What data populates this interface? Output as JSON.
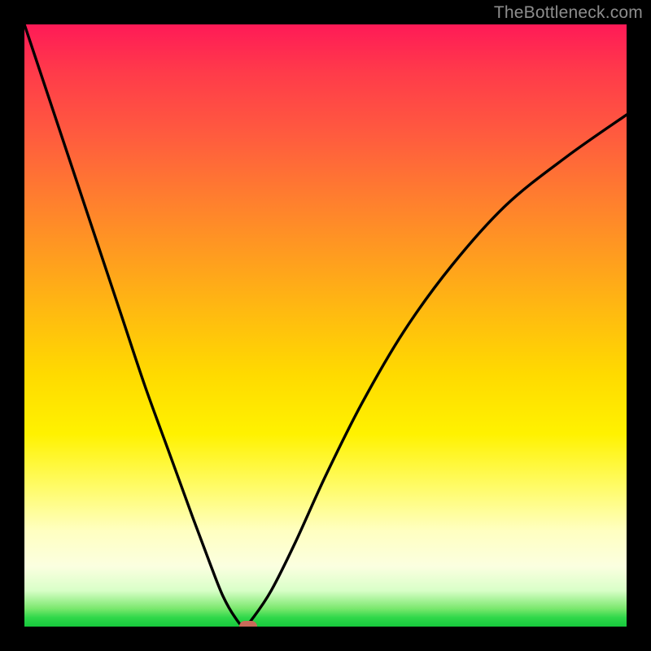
{
  "watermark": "TheBottleneck.com",
  "colors": {
    "frame": "#000000",
    "curve": "#000000",
    "marker": "#c96a5a",
    "gradient_stops": [
      "#ff1a57",
      "#ff3b4a",
      "#ff5a3f",
      "#ff7b30",
      "#ff9b20",
      "#ffbb10",
      "#ffda00",
      "#fff200",
      "#fffc6a",
      "#ffffc0",
      "#fbffe0",
      "#d9ffc8",
      "#7be86e",
      "#2fd84a",
      "#16c93c"
    ]
  },
  "chart_data": {
    "type": "line",
    "title": "",
    "xlabel": "",
    "ylabel": "",
    "xlim": [
      0,
      100
    ],
    "ylim": [
      0,
      100
    ],
    "note": "x is horizontal position (% of plot width), y is bottleneck magnitude (% of plot height from bottom). Curve has a single minimum near x≈37 where y≈0. Values estimated from pixels; no axis ticks present.",
    "series": [
      {
        "name": "bottleneck-curve",
        "x": [
          0,
          4,
          8,
          12,
          16,
          20,
          24,
          28,
          31,
          33,
          35,
          36.5,
          38,
          41,
          45,
          50,
          56,
          63,
          71,
          80,
          90,
          100
        ],
        "y": [
          100,
          88,
          76,
          64,
          52,
          40,
          29,
          18,
          10,
          5,
          1.5,
          0,
          1.5,
          6,
          14,
          25,
          37,
          49,
          60,
          70,
          78,
          85
        ]
      }
    ],
    "marker": {
      "x": 37.2,
      "y": 0
    }
  }
}
